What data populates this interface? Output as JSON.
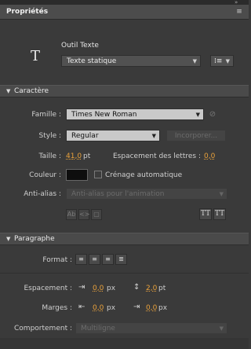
{
  "panel": {
    "tab_label": "Propriétés"
  },
  "tool": {
    "name": "Outil Texte",
    "type_select": "Texte statique",
    "type_icon": "T-text-tool-icon"
  },
  "caractere": {
    "header": "Caractère",
    "famille_label": "Famille :",
    "famille_value": "Times New Roman",
    "style_label": "Style :",
    "style_value": "Regular",
    "incorporer_label": "Incorporer...",
    "taille_label": "Taille :",
    "taille_value": "41,0",
    "taille_unit": "pt",
    "espacement_label": "Espacement des lettres :",
    "espacement_value": "0,0",
    "couleur_label": "Couleur :",
    "crenage_label": "Crénage automatique",
    "antialias_label": "Anti-alias :",
    "antialias_value": "Anti-alias pour l'animation"
  },
  "paragraphe": {
    "header": "Paragraphe",
    "format_label": "Format :",
    "espacement_label": "Espacement :",
    "espacement_indent_value": "0,0",
    "espacement_indent_unit": "px",
    "espacement_line_value": "2,0",
    "espacement_line_unit": "pt",
    "marges_label": "Marges :",
    "marges_left_value": "0,0",
    "marges_left_unit": "px",
    "marges_right_value": "0,0",
    "marges_right_unit": "px",
    "comportement_label": "Comportement :",
    "comportement_value": "Multiligne"
  }
}
